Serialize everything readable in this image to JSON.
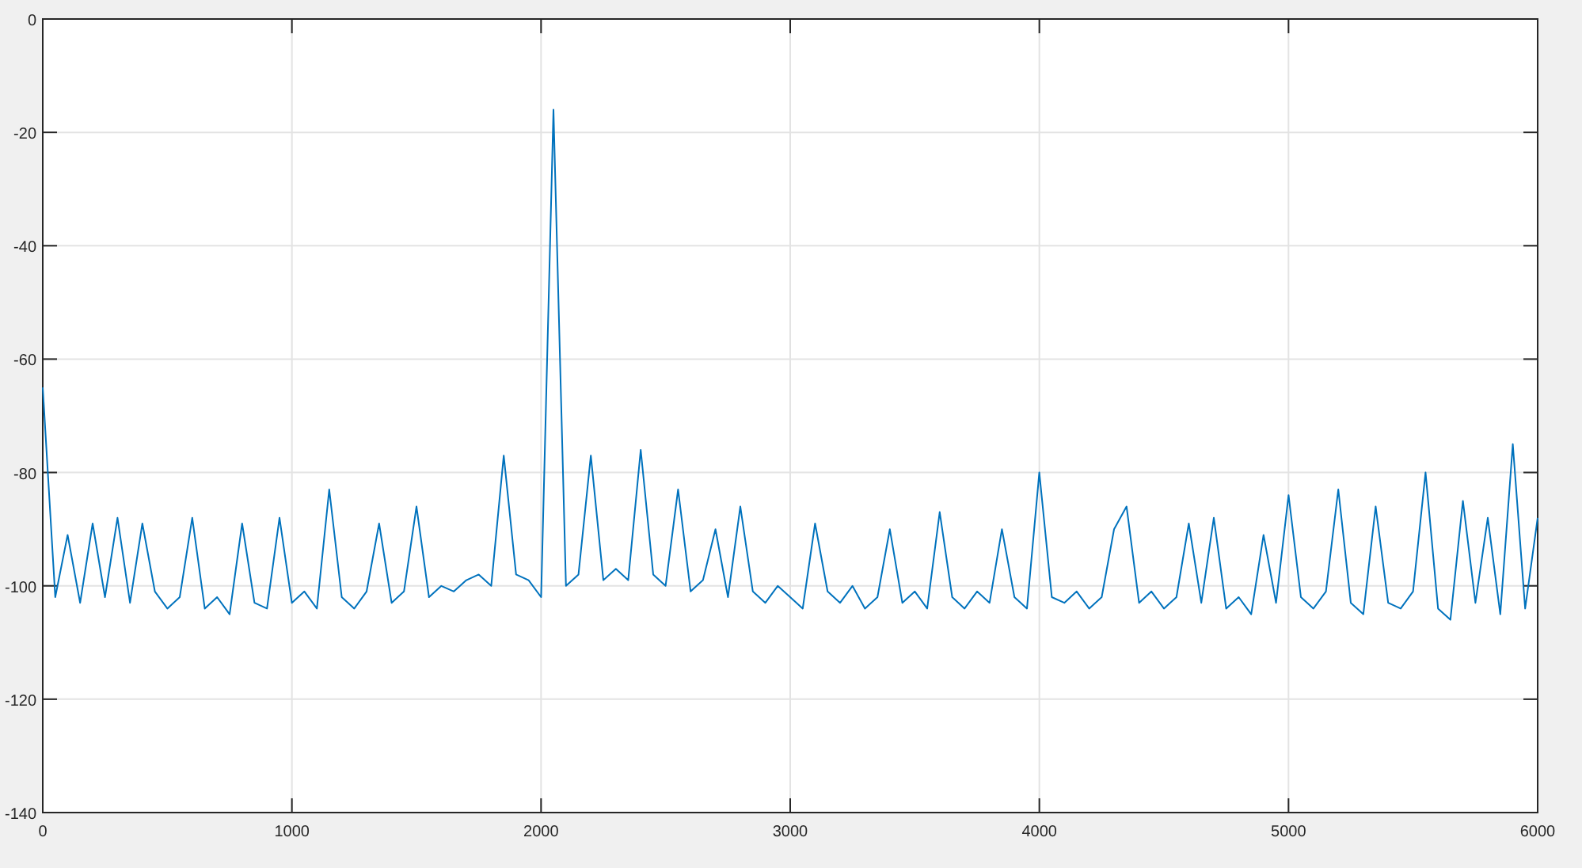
{
  "plot": {
    "chart_data": {
      "type": "line",
      "grid": true,
      "xlim": [
        0,
        6000
      ],
      "ylim": [
        -140,
        0
      ],
      "xticks": [
        0,
        1000,
        2000,
        3000,
        4000,
        5000,
        6000
      ],
      "yticks": [
        0,
        -20,
        -40,
        -60,
        -80,
        -100,
        -120,
        -140
      ],
      "x": [
        0,
        50,
        100,
        150,
        200,
        250,
        300,
        350,
        400,
        450,
        500,
        550,
        600,
        650,
        700,
        750,
        800,
        850,
        900,
        950,
        1000,
        1050,
        1100,
        1150,
        1200,
        1250,
        1300,
        1350,
        1400,
        1450,
        1500,
        1550,
        1600,
        1650,
        1700,
        1750,
        1800,
        1850,
        1900,
        1950,
        2000,
        2050,
        2100,
        2150,
        2200,
        2250,
        2300,
        2350,
        2400,
        2450,
        2500,
        2550,
        2600,
        2650,
        2700,
        2750,
        2800,
        2850,
        2900,
        2950,
        3000,
        3050,
        3100,
        3150,
        3200,
        3250,
        3300,
        3350,
        3400,
        3450,
        3500,
        3550,
        3600,
        3650,
        3700,
        3750,
        3800,
        3850,
        3900,
        3950,
        4000,
        4050,
        4100,
        4150,
        4200,
        4250,
        4300,
        4350,
        4400,
        4450,
        4500,
        4550,
        4600,
        4650,
        4700,
        4750,
        4800,
        4850,
        4900,
        4950,
        5000,
        5050,
        5100,
        5150,
        5200,
        5250,
        5300,
        5350,
        5400,
        5450,
        5500,
        5550,
        5600,
        5650,
        5700,
        5750,
        5800,
        5850,
        5900,
        5950,
        6000
      ],
      "series": [
        {
          "color": "#0072bd",
          "values": [
            -65,
            -102,
            -91,
            -103,
            -89,
            -102,
            -88,
            -103,
            -89,
            -101,
            -104,
            -102,
            -88,
            -104,
            -102,
            -105,
            -89,
            -103,
            -104,
            -88,
            -103,
            -101,
            -104,
            -83,
            -102,
            -104,
            -101,
            -89,
            -103,
            -101,
            -86,
            -102,
            -100,
            -101,
            -99,
            -98,
            -100,
            -77,
            -98,
            -99,
            -102,
            -16,
            -100,
            -98,
            -77,
            -99,
            -97,
            -99,
            -76,
            -98,
            -100,
            -83,
            -101,
            -99,
            -90,
            -102,
            -86,
            -101,
            -103,
            -100,
            -102,
            -104,
            -89,
            -101,
            -103,
            -100,
            -104,
            -102,
            -90,
            -103,
            -101,
            -104,
            -87,
            -102,
            -104,
            -101,
            -103,
            -90,
            -102,
            -104,
            -80,
            -102,
            -103,
            -101,
            -104,
            -102,
            -90,
            -86,
            -103,
            -101,
            -104,
            -102,
            -89,
            -103,
            -88,
            -104,
            -102,
            -105,
            -91,
            -103,
            -84,
            -102,
            -104,
            -101,
            -83,
            -103,
            -105,
            -86,
            -103,
            -104,
            -101,
            -80,
            -104,
            -106,
            -85,
            -103,
            -88,
            -105,
            -75,
            -104,
            -88
          ]
        }
      ]
    }
  }
}
